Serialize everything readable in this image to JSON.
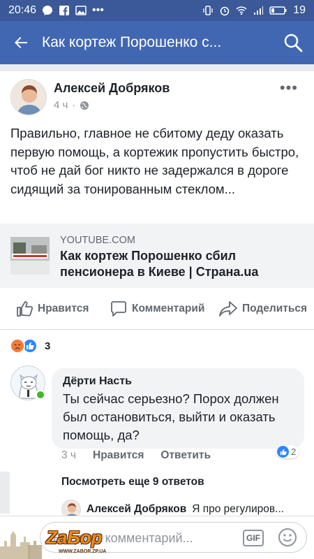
{
  "status_bar": {
    "time": "20:46",
    "battery": "19"
  },
  "app_bar": {
    "title": "Как кортеж Порошенко с..."
  },
  "post": {
    "author": "Алексей Добряков",
    "time": "4 ч",
    "text": "Правильно, главное не сбитому деду оказать первую помощь, а кортежик пропустить быстро, чтоб не дай бог никто не задержался в дороге сидящий за тонированным стеклом...",
    "link": {
      "domain": "YOUTUBE.COM",
      "title": "Как кортеж Порошенко сбил пенсионера в Киеве | Страна.ua"
    },
    "actions": {
      "like": "Нравится",
      "comment": "Комментарий",
      "share": "Поделиться"
    },
    "reaction_count": "3"
  },
  "comment": {
    "author": "Дёрти Насть",
    "text": "Ты сейчас серьезно? Порох должен был остановиться, выйти и оказать помощь, да?",
    "time": "3 ч",
    "like_label": "Нравится",
    "reply_label": "Ответить",
    "likes": "2"
  },
  "more_replies": "Посмотреть еще 9 ответов",
  "reply": {
    "author": "Алексей Добряков",
    "text": "Я про регулиров..."
  },
  "composer": {
    "placeholder": "Введите комментарий...",
    "gif": "GIF"
  },
  "watermark": {
    "text": "ZaБор",
    "sub": "WWW.ZABOR.ZP.UA"
  },
  "colors": {
    "header": "#4267b2",
    "status": "#3b5998",
    "like_blue": "#2d88ff",
    "online": "#42b72a"
  }
}
